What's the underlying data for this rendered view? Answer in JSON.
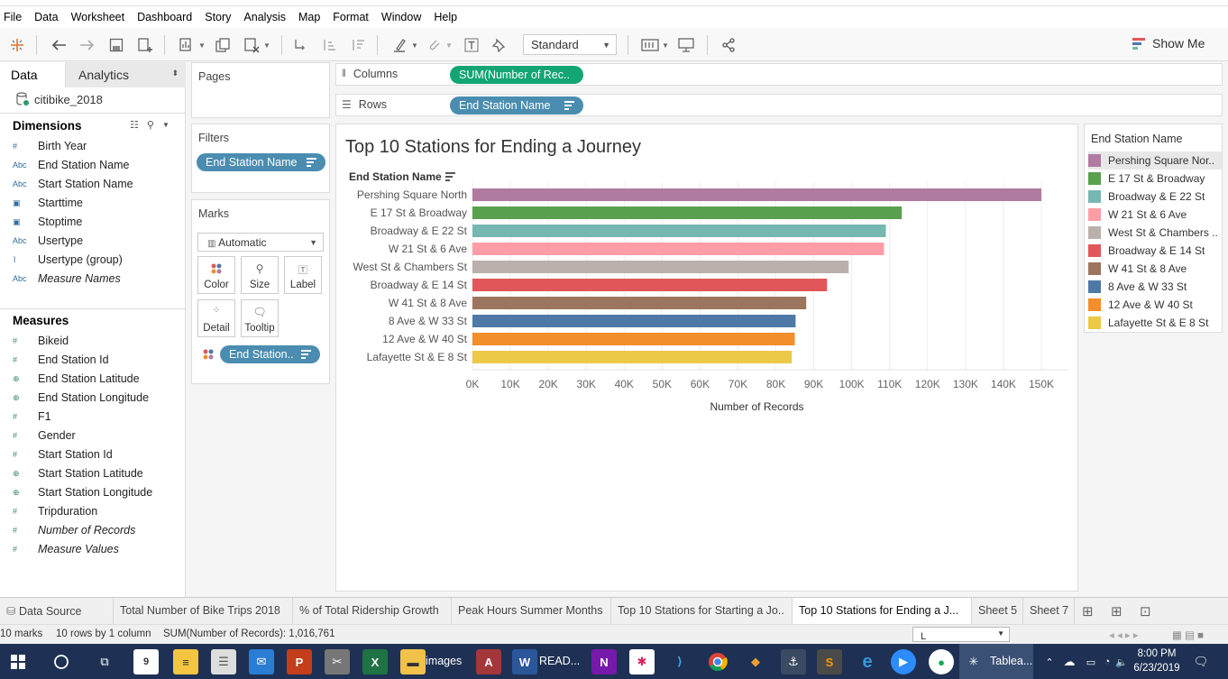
{
  "menu": [
    "File",
    "Data",
    "Worksheet",
    "Dashboard",
    "Story",
    "Analysis",
    "Map",
    "Format",
    "Window",
    "Help"
  ],
  "toolbar": {
    "fit_select": "Standard",
    "show_me": "Show Me"
  },
  "left_pane": {
    "tabs": {
      "data": "Data",
      "analytics": "Analytics"
    },
    "datasource": "citibike_2018",
    "dimensions_header": "Dimensions",
    "dimensions": [
      {
        "icon": "#",
        "label": "Birth Year",
        "italic": false
      },
      {
        "icon": "Abc",
        "label": "End Station Name",
        "italic": false
      },
      {
        "icon": "Abc",
        "label": "Start Station Name",
        "italic": false
      },
      {
        "icon": "date",
        "label": "Starttime",
        "italic": false
      },
      {
        "icon": "date",
        "label": "Stoptime",
        "italic": false
      },
      {
        "icon": "Abc",
        "label": "Usertype",
        "italic": false
      },
      {
        "icon": "clip",
        "label": "Usertype (group)",
        "italic": false
      },
      {
        "icon": "Abc",
        "label": "Measure Names",
        "italic": true
      }
    ],
    "measures_header": "Measures",
    "measures": [
      {
        "icon": "#",
        "label": "Bikeid",
        "italic": false
      },
      {
        "icon": "#",
        "label": "End Station Id",
        "italic": false
      },
      {
        "icon": "globe",
        "label": "End Station Latitude",
        "italic": false
      },
      {
        "icon": "globe",
        "label": "End Station Longitude",
        "italic": false
      },
      {
        "icon": "#",
        "label": "F1",
        "italic": false
      },
      {
        "icon": "#",
        "label": "Gender",
        "italic": false
      },
      {
        "icon": "#",
        "label": "Start Station Id",
        "italic": false
      },
      {
        "icon": "globe",
        "label": "Start Station Latitude",
        "italic": false
      },
      {
        "icon": "globe",
        "label": "Start Station Longitude",
        "italic": false
      },
      {
        "icon": "#",
        "label": "Tripduration",
        "italic": false
      },
      {
        "icon": "#",
        "label": "Number of Records",
        "italic": true
      },
      {
        "icon": "#",
        "label": "Measure Values",
        "italic": true
      }
    ]
  },
  "pages": {
    "title": "Pages"
  },
  "filters": {
    "title": "Filters",
    "pill": "End Station Name"
  },
  "marks": {
    "title": "Marks",
    "type": "Automatic",
    "buttons": {
      "color": "Color",
      "size": "Size",
      "label": "Label",
      "detail": "Detail",
      "tooltip": "Tooltip"
    },
    "pill": "End Station.."
  },
  "shelves": {
    "columns_label": "Columns",
    "columns_pill": "SUM(Number of Rec..",
    "rows_label": "Rows",
    "rows_pill": "End Station Name"
  },
  "chart_data": {
    "type": "bar",
    "orientation": "horizontal",
    "title": "Top 10 Stations for Ending a Journey",
    "row_header": "End Station Name",
    "xlabel": "Number of Records",
    "categories": [
      "Pershing Square North",
      "E 17 St & Broadway",
      "Broadway & E 22 St",
      "W 21 St & 6 Ave",
      "West St & Chambers St",
      "Broadway & E 14 St",
      "W 41 St & 8 Ave",
      "8 Ave & W 33 St",
      "12 Ave & W 40 St",
      "Lafayette St & E 8 St"
    ],
    "values": [
      150000,
      113200,
      109000,
      108500,
      99200,
      93500,
      88000,
      85200,
      85000,
      84200
    ],
    "colors": [
      "#b07aa1",
      "#59a14f",
      "#76b7b2",
      "#ff9da7",
      "#bab0ac",
      "#e15759",
      "#9c755f",
      "#4e79a7",
      "#f28e2b",
      "#edc948"
    ],
    "xlim": [
      0,
      150000
    ],
    "xticks": [
      0,
      10000,
      20000,
      30000,
      40000,
      50000,
      60000,
      70000,
      80000,
      90000,
      100000,
      110000,
      120000,
      130000,
      140000,
      150000
    ],
    "xtick_labels": [
      "0K",
      "10K",
      "20K",
      "30K",
      "40K",
      "50K",
      "60K",
      "70K",
      "80K",
      "90K",
      "100K",
      "110K",
      "120K",
      "130K",
      "140K",
      "150K"
    ],
    "grid": "vertical"
  },
  "legend": {
    "title": "End Station Name",
    "items": [
      "Pershing Square Nor..",
      "E 17 St & Broadway",
      "Broadway & E 22 St",
      "W 21 St & 6 Ave",
      "West St & Chambers ..",
      "Broadway & E 14 St",
      "W 41 St & 8 Ave",
      "8 Ave & W 33 St",
      "12 Ave & W 40 St",
      "Lafayette St & E 8 St"
    ]
  },
  "sheet_tabs": [
    "Data Source",
    "Total Number of Bike Trips 2018",
    "% of Total Ridership Growth",
    "Peak Hours Summer Months",
    "Top 10 Stations for Starting a Jo..",
    "Top 10 Stations for Ending a J...",
    "Sheet 5",
    "Sheet 7"
  ],
  "status": {
    "marks": "10 marks",
    "rows": "10 rows by 1 column",
    "sum": "SUM(Number of Records): 1,016,761",
    "selector": "L"
  },
  "taskbar": {
    "images_label": "images",
    "word_label": "READ...",
    "tableau_label": "Tablea...",
    "time": "8:00 PM",
    "date": "6/23/2019"
  }
}
